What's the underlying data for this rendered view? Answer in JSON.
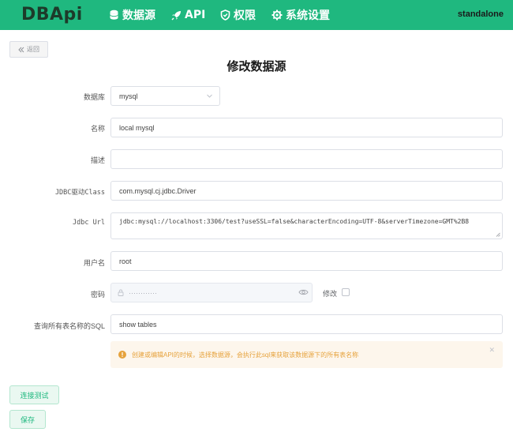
{
  "navbar": {
    "logo": "DBApi",
    "items": [
      {
        "label": "数据源",
        "icon": "database-icon"
      },
      {
        "label": "API",
        "icon": "rocket-icon"
      },
      {
        "label": "权限",
        "icon": "shield-icon"
      },
      {
        "label": "系统设置",
        "icon": "gear-icon"
      }
    ],
    "user": "standalone"
  },
  "back_label": "返回",
  "page_title": "修改数据源",
  "form": {
    "database": {
      "label": "数据库",
      "value": "mysql"
    },
    "name": {
      "label": "名称",
      "value": "local mysql"
    },
    "description": {
      "label": "描述",
      "value": ""
    },
    "jdbc_driver": {
      "label": "JDBC驱动Class",
      "value": "com.mysql.cj.jdbc.Driver"
    },
    "jdbc_url": {
      "label": "Jdbc Url",
      "value": "jdbc:mysql://localhost:3306/test?useSSL=false&characterEncoding=UTF-8&serverTimezone=GMT%2B8"
    },
    "username": {
      "label": "用户名",
      "value": "root"
    },
    "password": {
      "label": "密码",
      "value": "············",
      "modify_label": "修改"
    },
    "tables_sql": {
      "label": "查询所有表名称的SQL",
      "value": "show tables"
    }
  },
  "alert": {
    "text": "创建或编辑API的时候，选择数据源，会执行此sql来获取该数据源下的所有表名称",
    "color": "#e6a23c"
  },
  "buttons": {
    "test_connection": "连接测试",
    "save": "保存"
  },
  "colors": {
    "brand": "#1fb87f",
    "logo": "#1d3b2a"
  }
}
